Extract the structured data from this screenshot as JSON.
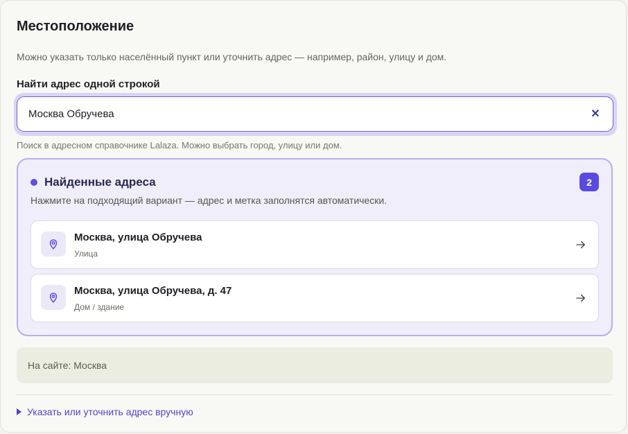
{
  "section": {
    "title": "Местоположение",
    "description": "Можно указать только населённый пункт или уточнить адрес — например, район, улицу и дом."
  },
  "search": {
    "label": "Найти адрес одной строкой",
    "value": "Москва Обручева",
    "clear_icon": "close-icon",
    "hint": "Поиск в адресном справочнике Lalaza. Можно выбрать город, улицу или дом."
  },
  "results": {
    "title": "Найденные адреса",
    "count": "2",
    "subtitle": "Нажмите на подходящий вариант — адрес и метка заполнятся автоматически.",
    "items": [
      {
        "title": "Москва, улица Обручева",
        "type": "Улица"
      },
      {
        "title": "Москва, улица Обручева, д. 47",
        "type": "Дом / здание"
      }
    ]
  },
  "site": {
    "text": "На сайте: Москва"
  },
  "manual": {
    "label": "Указать или уточнить адрес вручную"
  },
  "colors": {
    "accent": "#5b4ae0",
    "accent_light": "#efeefa",
    "site_bg": "#ebede1"
  }
}
